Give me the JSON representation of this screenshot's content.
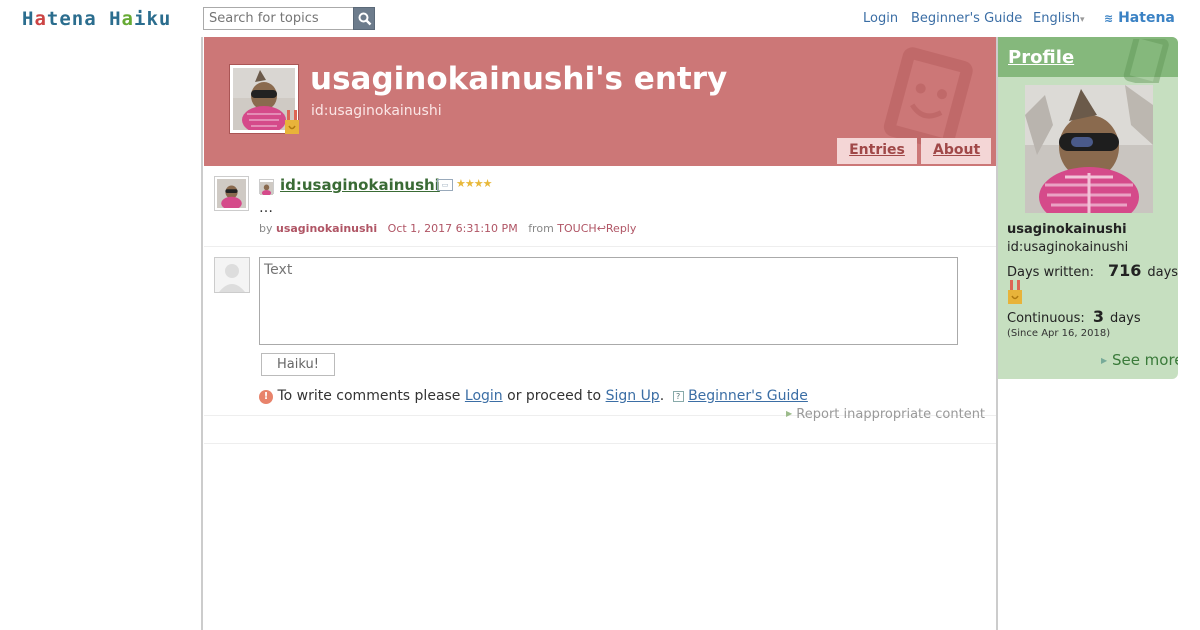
{
  "topbar": {
    "logo_part1": "H",
    "logo_a1": "a",
    "logo_part2": "tena H",
    "logo_a2": "a",
    "logo_part3": "iku",
    "search_placeholder": "Search for topics",
    "login": "Login",
    "beginners_guide": "Beginner's Guide",
    "language": "English",
    "hatena": "Hatena"
  },
  "header": {
    "title": "usaginokainushi's entry",
    "id": "id:usaginokainushi",
    "tab_entries": "Entries",
    "tab_about": "About"
  },
  "entry": {
    "user": "id:usaginokainushi",
    "stars": "★★★★",
    "text": "…",
    "by": "by",
    "username": "usaginokainushi",
    "date": "Oct 1, 2017 6:31:10 PM",
    "from_label": "from",
    "source": "TOUCH",
    "reply": "Reply"
  },
  "reply_form": {
    "placeholder": "Text",
    "submit": "Haiku!",
    "notice_prefix": "To write comments please",
    "login_link": "Login",
    "notice_middle": "or proceed to",
    "signup_link": "Sign Up",
    "notice_end": ".",
    "guide_link": "Beginner's Guide",
    "report": "Report inappropriate content"
  },
  "profile": {
    "title": "Profile",
    "name": "usaginokainushi",
    "id": "id:usaginokainushi",
    "days_written_label": "Days written:",
    "days_written_value": "716",
    "days_unit": "days",
    "continuous_label": "Continuous:",
    "continuous_value": "3",
    "since": "(Since Apr 16, 2018)",
    "see_more": "See more"
  },
  "colors": {
    "header_bg": "#cc7777",
    "profile_bg": "#c6dfc0",
    "profile_head": "#85b87c",
    "link": "#3b6ea5"
  }
}
